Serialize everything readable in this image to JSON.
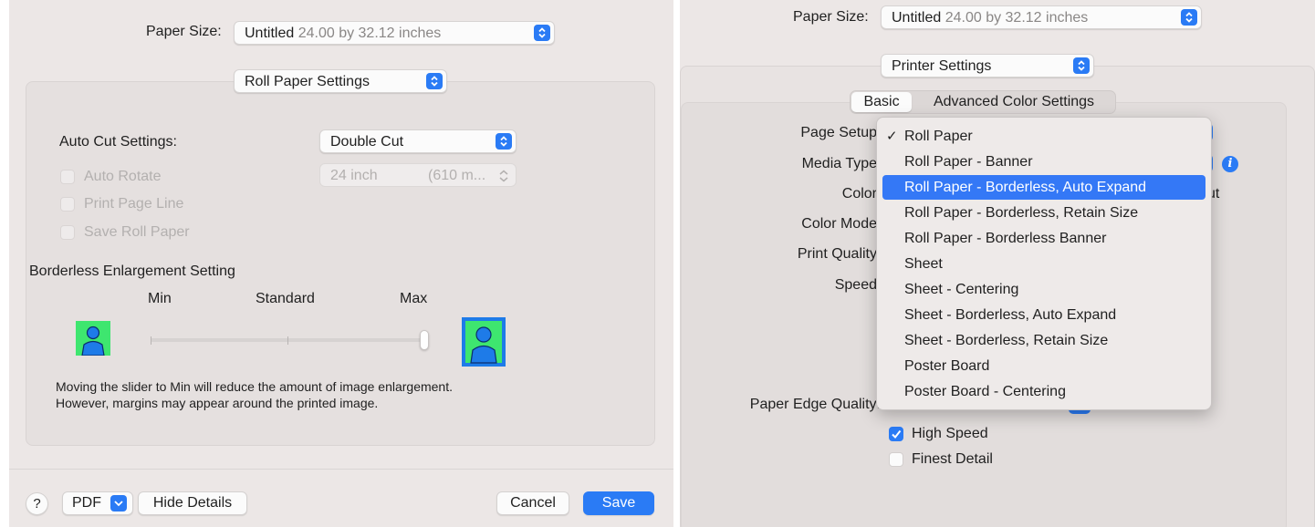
{
  "left": {
    "paper_size_label": "Paper Size:",
    "paper_size_name": "Untitled",
    "paper_size_dims": "24.00 by 32.12 inches",
    "section_select": "Roll Paper Settings",
    "auto_cut_label": "Auto Cut Settings:",
    "auto_cut_value": "Double Cut",
    "auto_rotate_label": "Auto Rotate",
    "roll_width_value": "24 inch",
    "roll_width_mm": "(610 m...",
    "print_page_line_label": "Print Page Line",
    "save_roll_paper_label": "Save Roll Paper",
    "borderless_heading": "Borderless Enlargement Setting",
    "slider_min": "Min",
    "slider_standard": "Standard",
    "slider_max": "Max",
    "slider_value_fraction": 1.0,
    "note_line1": "Moving the slider to Min will reduce the amount of image enlargement.",
    "note_line2": "However, margins may appear around the printed image.",
    "help_label": "?",
    "pdf_label": "PDF",
    "hide_details_label": "Hide Details",
    "cancel_label": "Cancel",
    "save_label": "Save"
  },
  "right": {
    "paper_size_label": "Paper Size:",
    "paper_size_name": "Untitled",
    "paper_size_dims": "24.00 by 32.12 inches",
    "section_select": "Printer Settings",
    "tabs": [
      {
        "label": "Basic",
        "selected": true
      },
      {
        "label": "Advanced Color Settings",
        "selected": false
      }
    ],
    "labels": {
      "page_setup": "Page Setup",
      "media_type": "Media Type",
      "color": "Color",
      "color_mode": "Color Mode",
      "print_quality": "Print Quality",
      "speed": "Speed",
      "paper_edge_quality": "Paper Edge Quality:",
      "color_partial": "ut"
    },
    "high_speed_label": "High Speed",
    "high_speed_checked": true,
    "finest_detail_label": "Finest Detail",
    "finest_detail_checked": false,
    "menu_items": [
      {
        "label": "Roll Paper",
        "checked": true,
        "highlighted": false
      },
      {
        "label": "Roll Paper - Banner",
        "checked": false,
        "highlighted": false
      },
      {
        "label": "Roll Paper - Borderless, Auto Expand",
        "checked": false,
        "highlighted": true
      },
      {
        "label": "Roll Paper - Borderless, Retain Size",
        "checked": false,
        "highlighted": false
      },
      {
        "label": "Roll Paper - Borderless Banner",
        "checked": false,
        "highlighted": false
      },
      {
        "label": "Sheet",
        "checked": false,
        "highlighted": false
      },
      {
        "label": "Sheet - Centering",
        "checked": false,
        "highlighted": false
      },
      {
        "label": "Sheet - Borderless, Auto Expand",
        "checked": false,
        "highlighted": false
      },
      {
        "label": "Sheet - Borderless, Retain Size",
        "checked": false,
        "highlighted": false
      },
      {
        "label": "Poster Board",
        "checked": false,
        "highlighted": false
      },
      {
        "label": "Poster Board - Centering",
        "checked": false,
        "highlighted": false
      }
    ],
    "checkmark_glyph": "✓",
    "info_glyph": "i"
  },
  "colors": {
    "accent": "#2a7bf5",
    "highlight": "#3478f6",
    "panel_bg": "#ece7e6"
  }
}
